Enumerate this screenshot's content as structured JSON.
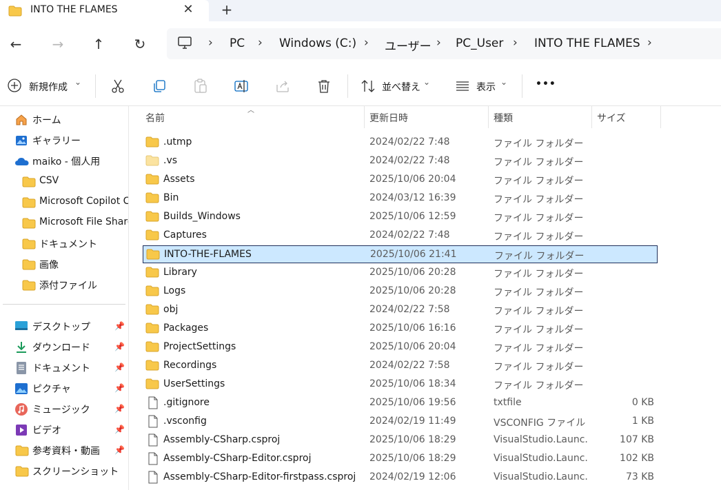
{
  "tab": {
    "title": "INTO THE FLAMES",
    "close": "✕",
    "new_tab": "+"
  },
  "nav": {
    "back": "←",
    "forward": "→",
    "up": "↑",
    "refresh": "↻"
  },
  "breadcrumb": {
    "items": [
      "PC",
      "Windows (C:)",
      "ユーザー",
      "PC_User",
      "INTO THE FLAMES"
    ],
    "sep": "›"
  },
  "toolbar": {
    "new_label": "新規作成",
    "sort_label": "並べ替え",
    "view_label": "表示",
    "more_label": "•••",
    "chevron": "⌄"
  },
  "sidebar": {
    "top": [
      {
        "label": "ホーム",
        "icon": "home-icon"
      },
      {
        "label": "ギャラリー",
        "icon": "gallery-icon"
      },
      {
        "label": "maiko - 個人用",
        "icon": "onedrive-icon"
      }
    ],
    "folders": [
      {
        "label": "CSV"
      },
      {
        "label": "Microsoft Copilot C"
      },
      {
        "label": "Microsoft File Share"
      },
      {
        "label": "ドキュメント"
      },
      {
        "label": "画像"
      },
      {
        "label": "添付ファイル"
      }
    ],
    "quick": [
      {
        "label": "デスクトップ",
        "icon": "desktop-icon",
        "pinned": true
      },
      {
        "label": "ダウンロード",
        "icon": "download-icon",
        "pinned": true
      },
      {
        "label": "ドキュメント",
        "icon": "documents-icon",
        "pinned": true
      },
      {
        "label": "ピクチャ",
        "icon": "pictures-icon",
        "pinned": true
      },
      {
        "label": "ミュージック",
        "icon": "music-icon",
        "pinned": true
      },
      {
        "label": "ビデオ",
        "icon": "videos-icon",
        "pinned": true
      },
      {
        "label": "参考資料・動画",
        "icon": "folder-icon",
        "pinned": true
      },
      {
        "label": "スクリーンショット",
        "icon": "folder-icon",
        "pinned": false
      }
    ]
  },
  "columns": {
    "name": "名前",
    "date": "更新日時",
    "type": "種類",
    "size": "サイズ"
  },
  "files": [
    {
      "name": ".utmp",
      "date": "2024/02/22 7:48",
      "type": "ファイル フォルダー",
      "size": "",
      "kind": "folder"
    },
    {
      "name": ".vs",
      "date": "2024/02/22 7:48",
      "type": "ファイル フォルダー",
      "size": "",
      "kind": "folder-hidden"
    },
    {
      "name": "Assets",
      "date": "2025/10/06 20:04",
      "type": "ファイル フォルダー",
      "size": "",
      "kind": "folder"
    },
    {
      "name": "Bin",
      "date": "2024/03/12 16:39",
      "type": "ファイル フォルダー",
      "size": "",
      "kind": "folder"
    },
    {
      "name": "Builds_Windows",
      "date": "2025/10/06 12:59",
      "type": "ファイル フォルダー",
      "size": "",
      "kind": "folder"
    },
    {
      "name": "Captures",
      "date": "2024/02/22 7:48",
      "type": "ファイル フォルダー",
      "size": "",
      "kind": "folder"
    },
    {
      "name": "INTO-THE-FLAMES",
      "date": "2025/10/06 21:41",
      "type": "ファイル フォルダー",
      "size": "",
      "kind": "folder",
      "selected": true
    },
    {
      "name": "Library",
      "date": "2025/10/06 20:28",
      "type": "ファイル フォルダー",
      "size": "",
      "kind": "folder"
    },
    {
      "name": "Logs",
      "date": "2025/10/06 20:28",
      "type": "ファイル フォルダー",
      "size": "",
      "kind": "folder"
    },
    {
      "name": "obj",
      "date": "2024/02/22 7:58",
      "type": "ファイル フォルダー",
      "size": "",
      "kind": "folder"
    },
    {
      "name": "Packages",
      "date": "2025/10/06 16:16",
      "type": "ファイル フォルダー",
      "size": "",
      "kind": "folder"
    },
    {
      "name": "ProjectSettings",
      "date": "2025/10/06 20:04",
      "type": "ファイル フォルダー",
      "size": "",
      "kind": "folder"
    },
    {
      "name": "Recordings",
      "date": "2024/02/22 7:58",
      "type": "ファイル フォルダー",
      "size": "",
      "kind": "folder"
    },
    {
      "name": "UserSettings",
      "date": "2025/10/06 18:34",
      "type": "ファイル フォルダー",
      "size": "",
      "kind": "folder"
    },
    {
      "name": ".gitignore",
      "date": "2025/10/06 19:56",
      "type": "txtfile",
      "size": "0 KB",
      "kind": "file"
    },
    {
      "name": ".vsconfig",
      "date": "2024/02/19 11:49",
      "type": "VSCONFIG ファイル",
      "size": "1 KB",
      "kind": "file"
    },
    {
      "name": "Assembly-CSharp.csproj",
      "date": "2025/10/06 18:29",
      "type": "VisualStudio.Launc...",
      "size": "107 KB",
      "kind": "file"
    },
    {
      "name": "Assembly-CSharp-Editor.csproj",
      "date": "2025/10/06 18:29",
      "type": "VisualStudio.Launc...",
      "size": "102 KB",
      "kind": "file"
    },
    {
      "name": "Assembly-CSharp-Editor-firstpass.csproj",
      "date": "2024/02/19 12:06",
      "type": "VisualStudio.Launc...",
      "size": "73 KB",
      "kind": "file"
    }
  ],
  "colors": {
    "folder": "#f8c84a",
    "selection": "#cce8ff",
    "accent": "#0067c0"
  }
}
